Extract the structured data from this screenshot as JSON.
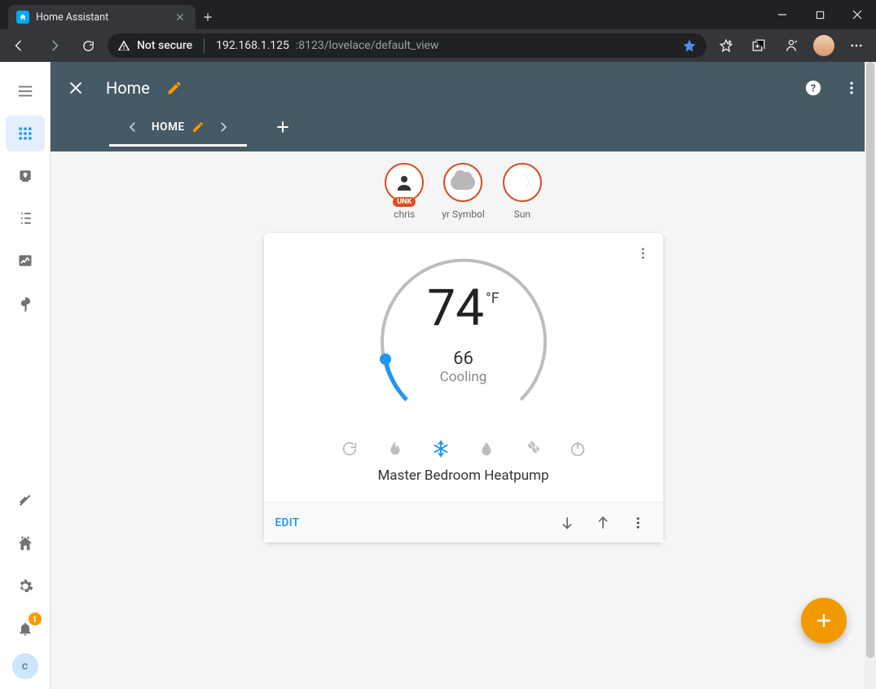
{
  "browser": {
    "tab_title": "Home Assistant",
    "security_label": "Not secure",
    "url_host": "192.168.1.125",
    "url_port_path": ":8123/lovelace/default_view"
  },
  "rail": {
    "notification_count": "1",
    "profile_initial": "c"
  },
  "appbar": {
    "title": "Home",
    "view_tab_label": "HOME"
  },
  "badges": [
    {
      "key": "chris",
      "label": "chris",
      "chip": "UNK",
      "type": "person"
    },
    {
      "key": "yr",
      "label": "yr Symbol",
      "type": "weather"
    },
    {
      "key": "sun",
      "label": "Sun",
      "type": "night"
    }
  ],
  "thermostat": {
    "current_temp": "74",
    "unit": "°F",
    "setpoint": "66",
    "mode_label": "Cooling",
    "device_name": "Master Bedroom Heatpump",
    "edit_label": "EDIT",
    "active_mode": "cool"
  },
  "colors": {
    "appbar_bg": "#455a64",
    "accent": "#2196f3",
    "fab": "#f29900",
    "badge_ring": "#d55022"
  }
}
